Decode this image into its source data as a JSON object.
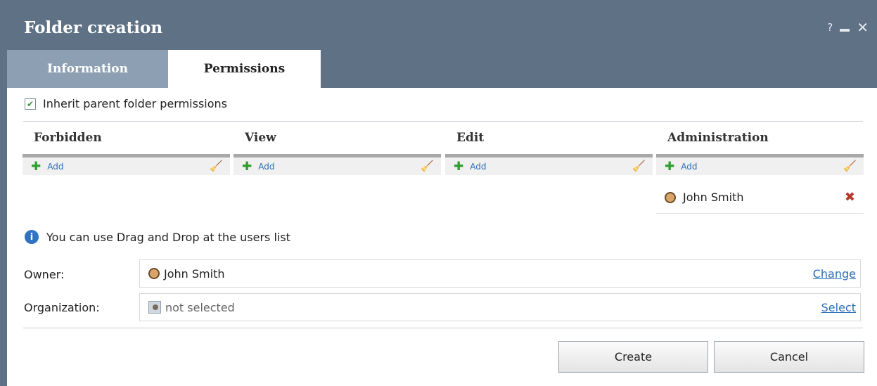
{
  "window": {
    "title": "Folder creation",
    "help_glyph": "?",
    "controls": [
      "help-icon",
      "minimize-icon",
      "close-icon"
    ]
  },
  "tabs": [
    {
      "label": "Information",
      "active": false
    },
    {
      "label": "Permissions",
      "active": true
    }
  ],
  "inherit": {
    "label": "Inherit parent folder permissions",
    "checked": true
  },
  "columns": [
    {
      "header": "Forbidden",
      "add_label": "Add",
      "users": []
    },
    {
      "header": "View",
      "add_label": "Add",
      "users": []
    },
    {
      "header": "Edit",
      "add_label": "Add",
      "users": []
    },
    {
      "header": "Administration",
      "add_label": "Add",
      "users": [
        "John Smith"
      ]
    }
  ],
  "hint": "You can use Drag and Drop at the users list",
  "owner": {
    "label": "Owner:",
    "value": "John Smith",
    "link": "Change"
  },
  "organization": {
    "label": "Organization:",
    "value": "not selected",
    "link": "Select"
  },
  "buttons": {
    "create": "Create",
    "cancel": "Cancel"
  },
  "colors": {
    "header_bg": "#5e7185",
    "inactive_tab": "#8da0b3",
    "link": "#2b6fb6",
    "add_icon": "#2e9e2e",
    "remove_icon": "#b33a2a"
  }
}
